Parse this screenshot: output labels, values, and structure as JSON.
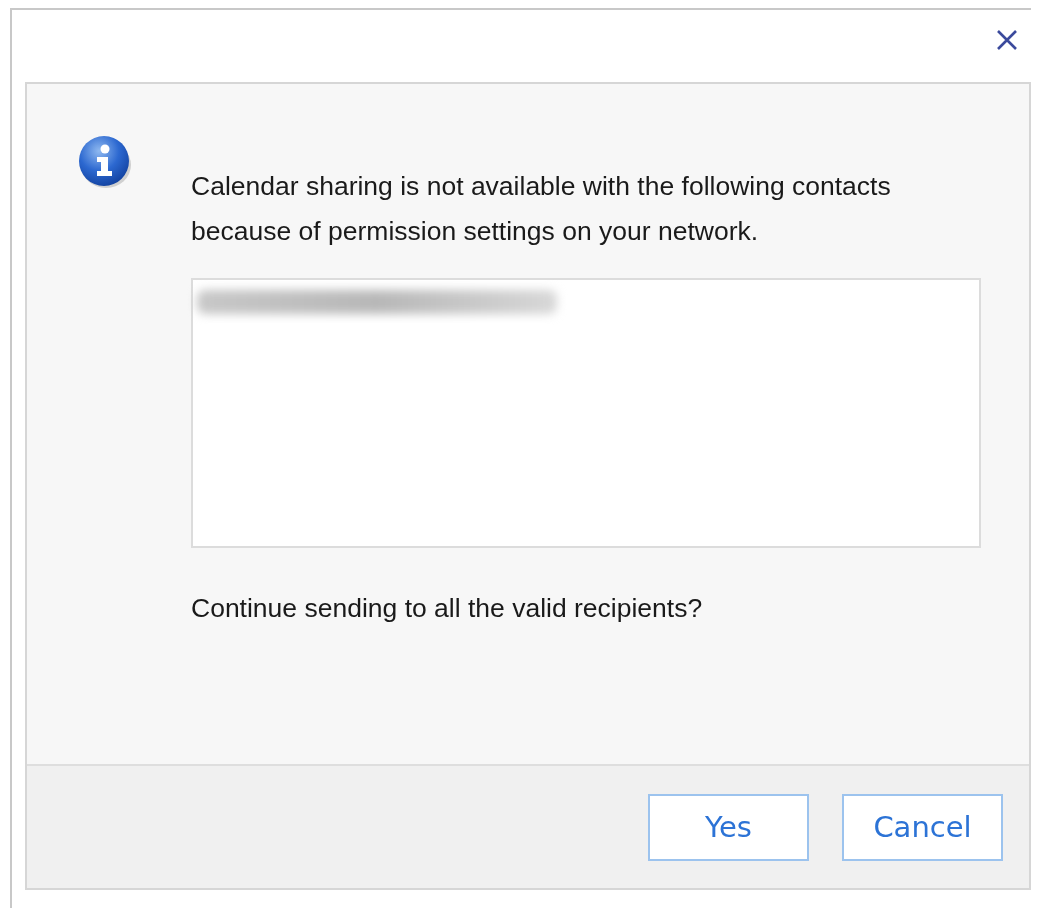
{
  "message": "Calendar sharing is not available with the following contacts because of permission settings on your network.",
  "recipients": [
    {
      "kind": "blurred"
    }
  ],
  "question": "Continue sending to all the valid recipients?",
  "buttons": [
    "Yes",
    "Cancel"
  ]
}
